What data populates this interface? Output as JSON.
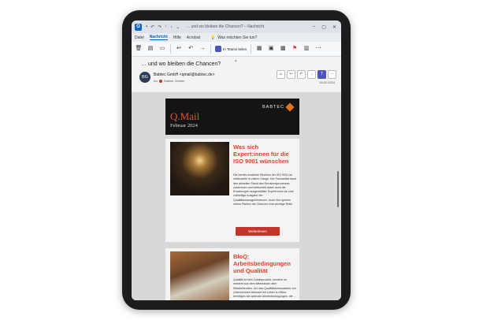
{
  "titlebar": {
    "title": "… und wo bleiben die Chancen? – Nachricht",
    "app_logo": "O"
  },
  "ribbon": {
    "tabs": [
      "Datei",
      "Nachricht",
      "Hilfe",
      "Acrobat"
    ],
    "active_tab": "Nachricht",
    "tell_me": "Was möchten Sie tun?",
    "teams_label": "In Teams teilen"
  },
  "message": {
    "subject": "… und wo bleiben die Chancen?",
    "avatar_initials": "BG",
    "from": "Babtec GmbH <qmail@babtec.de>",
    "to_prefix": "An",
    "to": "Sabine Jensen",
    "date": "15.02.2024"
  },
  "newsletter": {
    "brand": "Q.Mail",
    "issue": "Februar 2024",
    "logo_text": "BABTEC",
    "article1": {
      "title": "Was sich Expert:innen für die ISO 9001 wünschen",
      "body": "Die bereits erwähnte Revision der ISO 9001 ist mittlerweile in vollem Gange. Der Fachartikel fasst den aktuellen Stand des Revisionsprozesses zusammen und beleuchtet dabei auch die Erwartungen ausgewählter Expert:innen an eine zukünftige Ausgabe der Qualitätsmanagementnorm. Auch hier spielen neben Risiken die Chancen eine wichtige Rolle.",
      "cta": "Weiterlesen"
    },
    "article2": {
      "title": "BloQ: Arbeitsbedingungen und Qualität",
      "body": "Qualität ist kein Zufallsprodukt, sondern es entsteht aus dem Miteinander aller Mitarbeitenden. Um das Qualitätsbewusstsein von Unternehmen wirksam mit Leben zu füllen, benötigen sie optimale Arbeitsbedingungen, die ..."
    }
  },
  "colors": {
    "accent_red": "#d9452a",
    "outlook_blue": "#0a64c2",
    "banner_bg": "#141414"
  }
}
